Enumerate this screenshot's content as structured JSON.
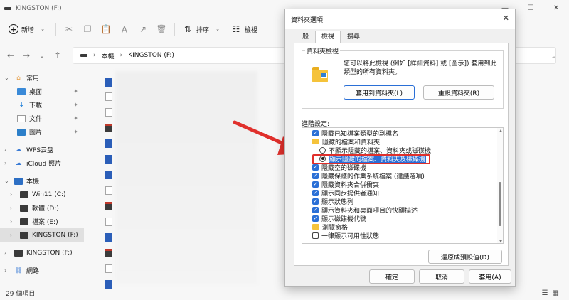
{
  "explorer": {
    "title": "KINGSTON (F:)",
    "window_controls": [
      "—",
      "☐",
      "✕"
    ],
    "toolbar": {
      "new_label": "新增",
      "sort_label": "排序",
      "view_label": "檢視"
    },
    "breadcrumb": {
      "root": "本機",
      "current": "KINGSTON (F:)"
    },
    "sidebar": {
      "home": "常用",
      "pinned": [
        "桌面",
        "下載",
        "文件",
        "圖片"
      ],
      "wps": "WPS云盘",
      "icloud": "iCloud 照片",
      "this_pc": "本機",
      "drives": [
        "Win11 (C:)",
        "軟體 (D:)",
        "檔案 (E:)",
        "KINGSTON (F:)"
      ],
      "kingston": "KINGSTON (F:)",
      "network": "網路"
    },
    "status": "29 個項目"
  },
  "dialog": {
    "title": "資料夾選項",
    "tabs": [
      "一般",
      "檢視",
      "搜尋"
    ],
    "active_tab": "檢視",
    "folder_views": {
      "legend": "資料夾檢視",
      "description": "您可以將此檢視 (例如 [詳細資料] 或 [圖示]) 套用到此類型的所有資料夾。",
      "apply_button": "套用到資料夾(L)",
      "reset_button": "重設資料夾(R)"
    },
    "advanced_label": "進階設定:",
    "advanced_items": [
      {
        "label": "隱藏已知檔案類型的副檔名",
        "kind": "checkbox",
        "checked": true,
        "indent": 0
      },
      {
        "label": "隱藏的檔案和資料夾",
        "kind": "folder",
        "indent": 0
      },
      {
        "label": "不顯示隱藏的檔案、資料夾或磁碟機",
        "kind": "radio",
        "checked": false,
        "indent": 1
      },
      {
        "label": "顯示隱藏的檔案、資料夾及磁碟機",
        "kind": "radio",
        "checked": true,
        "indent": 1,
        "highlighted": true
      },
      {
        "label": "隱藏空的磁碟機",
        "kind": "checkbox",
        "checked": true,
        "indent": 0
      },
      {
        "label": "隱藏保護的作業系統檔案 (建議選項)",
        "kind": "checkbox",
        "checked": true,
        "indent": 0
      },
      {
        "label": "隱藏資料夾合併衝突",
        "kind": "checkbox",
        "checked": true,
        "indent": 0
      },
      {
        "label": "顯示同步提供者通知",
        "kind": "checkbox",
        "checked": true,
        "indent": 0
      },
      {
        "label": "顯示狀態列",
        "kind": "checkbox",
        "checked": true,
        "indent": 0
      },
      {
        "label": "顯示資料夾和桌面項目的快顯描述",
        "kind": "checkbox",
        "checked": true,
        "indent": 0
      },
      {
        "label": "顯示磁碟機代號",
        "kind": "checkbox",
        "checked": true,
        "indent": 0
      },
      {
        "label": "瀏覽窗格",
        "kind": "folder",
        "indent": 0
      },
      {
        "label": "一律顯示可用性狀態",
        "kind": "checkbox",
        "checked": false,
        "indent": 0
      }
    ],
    "restore_defaults": "還原成預設值(D)",
    "ok": "確定",
    "cancel": "取消",
    "apply": "套用(A)"
  },
  "colors": {
    "accent": "#2a6fd6",
    "annotation_red": "#e0302c"
  }
}
